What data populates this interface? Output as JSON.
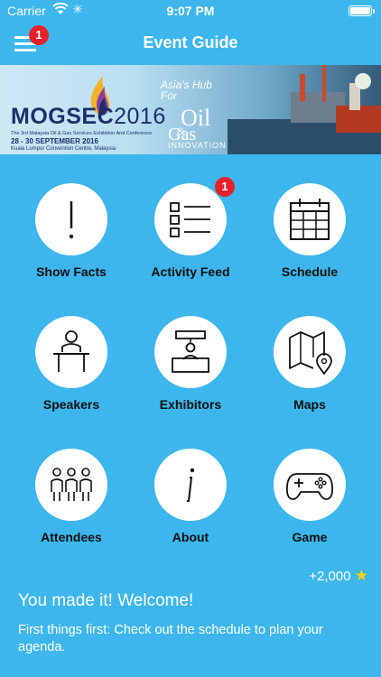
{
  "status_bar": {
    "carrier": "Carrier",
    "time": "9:07 PM",
    "battery_level": 1.0
  },
  "nav": {
    "title": "Event Guide",
    "menu_badge": "1"
  },
  "banner": {
    "brand": "MOGSEC",
    "year": "2016",
    "subtitle": "The 3rd Malaysia Oil & Gas Services Exhibition And Conference",
    "dates": "28 - 30 SEPTEMBER 2016",
    "venue": "Kuala Lumpur Convention Centre, Malaysia",
    "hub_line1": "Asia's Hub",
    "hub_line2": "For",
    "oil": "Oil",
    "amp": "&",
    "gas": "Gas",
    "innovation": "INNOVATION"
  },
  "tiles": [
    {
      "label": "Show Facts",
      "icon": "exclamation-icon"
    },
    {
      "label": "Activity Feed",
      "icon": "list-icon",
      "badge": "1"
    },
    {
      "label": "Schedule",
      "icon": "calendar-icon"
    },
    {
      "label": "Speakers",
      "icon": "speaker-podium-icon"
    },
    {
      "label": "Exhibitors",
      "icon": "exhibitor-booth-icon"
    },
    {
      "label": "Maps",
      "icon": "map-pin-icon"
    },
    {
      "label": "Attendees",
      "icon": "people-group-icon"
    },
    {
      "label": "About",
      "icon": "info-icon"
    },
    {
      "label": "Game",
      "icon": "gamepad-icon"
    }
  ],
  "rewards": {
    "points": "+2,000"
  },
  "welcome": {
    "title": "You made it! Welcome!",
    "text": "First things first: Check out the schedule to plan your agenda."
  },
  "colors": {
    "background": "#3cb6ec",
    "badge": "#e8202a",
    "star": "#ffd400"
  }
}
